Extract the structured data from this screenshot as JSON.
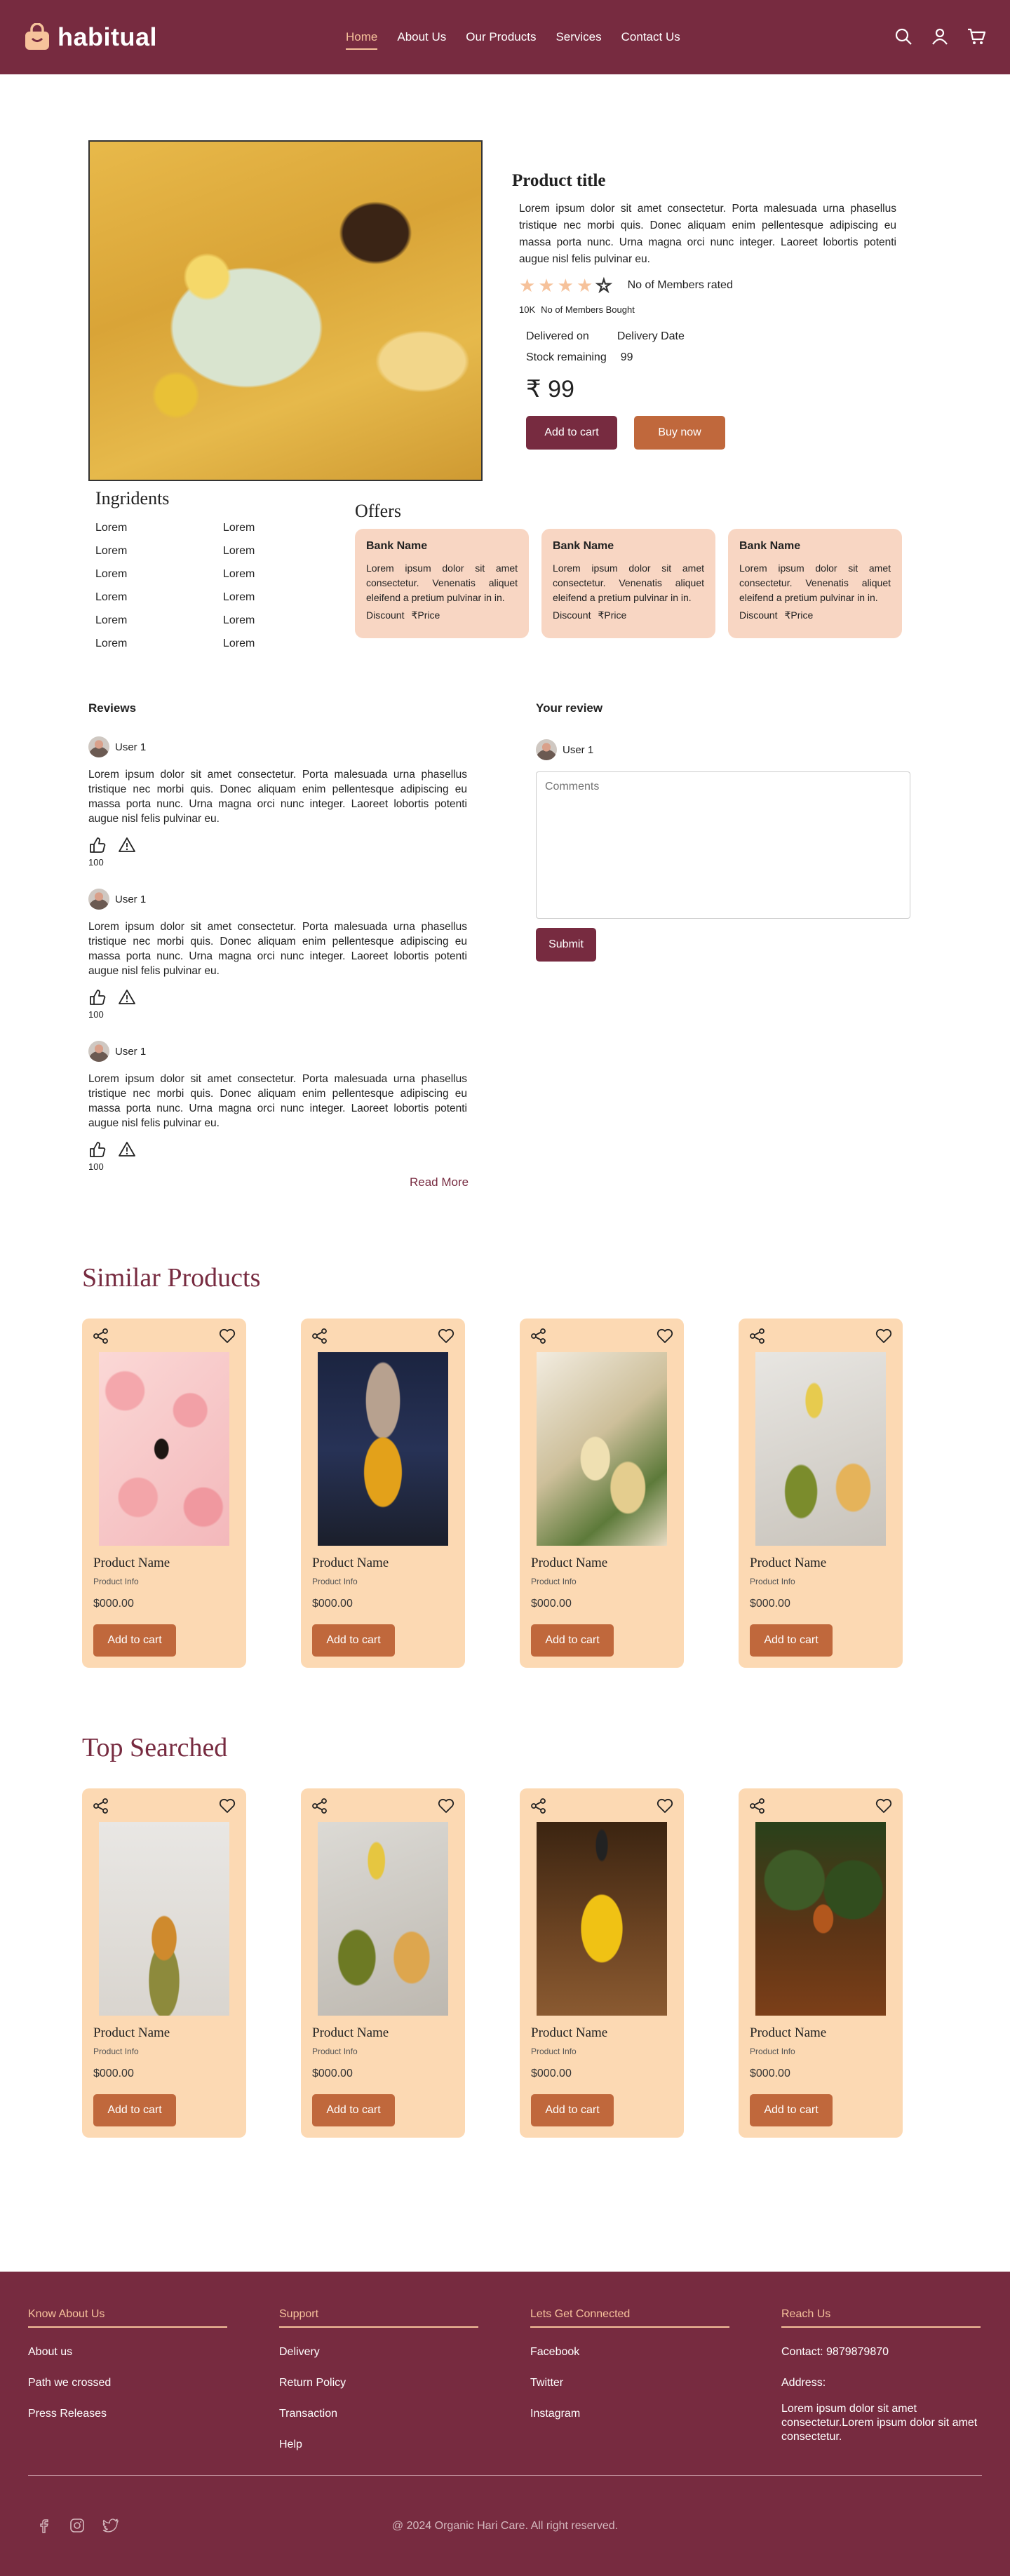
{
  "header": {
    "brand": "habitual",
    "nav": [
      {
        "label": "Home",
        "active": true
      },
      {
        "label": "About Us"
      },
      {
        "label": "Our Products"
      },
      {
        "label": "Services"
      },
      {
        "label": "Contact Us"
      }
    ],
    "icons": [
      "search-icon",
      "user-icon",
      "cart-icon"
    ]
  },
  "product": {
    "title": "Product title",
    "description": "Lorem ipsum dolor sit amet consectetur. Porta malesuada urna phasellus tristique nec morbi quis. Donec aliquam enim pellentesque adipiscing eu massa porta nunc. Urna magna orci nunc integer. Laoreet lobortis potenti augue nisl felis pulvinar eu.",
    "rating": 4,
    "rating_max": 5,
    "rated_label": "No of Members rated",
    "bought_count": "10K",
    "bought_label": "No of Members Bought",
    "delivered_label": "Delivered on",
    "delivery_value": "Delivery Date",
    "stock_label": "Stock remaining",
    "stock_value": "99",
    "price": "₹ 99",
    "add_to_cart": "Add to cart",
    "buy_now": "Buy now"
  },
  "ingredients": {
    "title": "Ingridents",
    "items": [
      "Lorem",
      "Lorem",
      "Lorem",
      "Lorem",
      "Lorem",
      "Lorem",
      "Lorem",
      "Lorem",
      "Lorem",
      "Lorem",
      "Lorem",
      "Lorem"
    ]
  },
  "offers": {
    "title": "Offers",
    "cards": [
      {
        "bank": "Bank Name",
        "desc": "Lorem ipsum dolor sit amet consectetur. Venenatis aliquet eleifend a pretium pulvinar in in.",
        "discount": "Discount",
        "price": "₹Price"
      },
      {
        "bank": "Bank Name",
        "desc": "Lorem ipsum dolor sit amet consectetur. Venenatis aliquet eleifend a pretium pulvinar in in.",
        "discount": "Discount",
        "price": "₹Price"
      },
      {
        "bank": "Bank Name",
        "desc": "Lorem ipsum dolor sit amet consectetur. Venenatis aliquet eleifend a pretium pulvinar in in.",
        "discount": "Discount",
        "price": "₹Price"
      }
    ]
  },
  "reviews": {
    "title": "Reviews",
    "items": [
      {
        "user": "User 1",
        "text": "Lorem ipsum dolor sit amet consectetur. Porta malesuada urna phasellus tristique nec morbi quis. Donec aliquam enim pellentesque adipiscing eu massa porta nunc. Urna magna orci nunc integer. Laoreet lobortis potenti augue nisl felis pulvinar eu.",
        "likes": "100"
      },
      {
        "user": "User 1",
        "text": "Lorem ipsum dolor sit amet consectetur. Porta malesuada urna phasellus tristique nec morbi quis. Donec aliquam enim pellentesque adipiscing eu massa porta nunc. Urna magna orci nunc integer. Laoreet lobortis potenti augue nisl felis pulvinar eu.",
        "likes": "100"
      },
      {
        "user": "User 1",
        "text": "Lorem ipsum dolor sit amet consectetur. Porta malesuada urna phasellus tristique nec morbi quis. Donec aliquam enim pellentesque adipiscing eu massa porta nunc. Urna magna orci nunc integer. Laoreet lobortis potenti augue nisl felis pulvinar eu.",
        "likes": "100"
      }
    ],
    "read_more": "Read More"
  },
  "your_review": {
    "title": "Your review",
    "user": "User 1",
    "placeholder": "Comments",
    "submit": "Submit"
  },
  "similar": {
    "title": "Similar Products",
    "cards": [
      {
        "name": "Product Name",
        "info": "Product Info",
        "price": "$000.00",
        "button": "Add to cart"
      },
      {
        "name": "Product Name",
        "info": "Product Info",
        "price": "$000.00",
        "button": "Add to cart"
      },
      {
        "name": "Product Name",
        "info": "Product Info",
        "price": "$000.00",
        "button": "Add to cart"
      },
      {
        "name": "Product Name",
        "info": "Product Info",
        "price": "$000.00",
        "button": "Add to cart"
      }
    ]
  },
  "top": {
    "title": "Top Searched",
    "cards": [
      {
        "name": "Product Name",
        "info": "Product Info",
        "price": "$000.00",
        "button": "Add to cart"
      },
      {
        "name": "Product Name",
        "info": "Product Info",
        "price": "$000.00",
        "button": "Add to cart"
      },
      {
        "name": "Product Name",
        "info": "Product Info",
        "price": "$000.00",
        "button": "Add to cart"
      },
      {
        "name": "Product Name",
        "info": "Product Info",
        "price": "$000.00",
        "button": "Add to cart"
      }
    ]
  },
  "footer": {
    "col1": {
      "title": "Know About Us",
      "links": [
        "About us",
        "Path we crossed",
        "Press Releases"
      ]
    },
    "col2": {
      "title": "Support",
      "links": [
        "Delivery",
        "Return Policy",
        "Transaction",
        "Help"
      ]
    },
    "col3": {
      "title": "Lets Get Connected",
      "links": [
        "Facebook",
        "Twitter",
        "Instagram"
      ]
    },
    "col4": {
      "title": "Reach Us",
      "contact": "Contact: 9879879870",
      "address_label": "Address:",
      "address": "Lorem ipsum dolor sit amet consectetur.Lorem ipsum dolor sit amet consectetur."
    },
    "social": [
      "facebook-icon",
      "instagram-icon",
      "twitter-icon"
    ],
    "copyright": "@ 2024 Organic Hari Care. All right reserved."
  },
  "colors": {
    "brand": "#772b40",
    "accent": "#f6c29b",
    "button_secondary": "#c0683c",
    "card_bg": "#fcd9b3",
    "offer_bg": "#f8d6c3"
  }
}
